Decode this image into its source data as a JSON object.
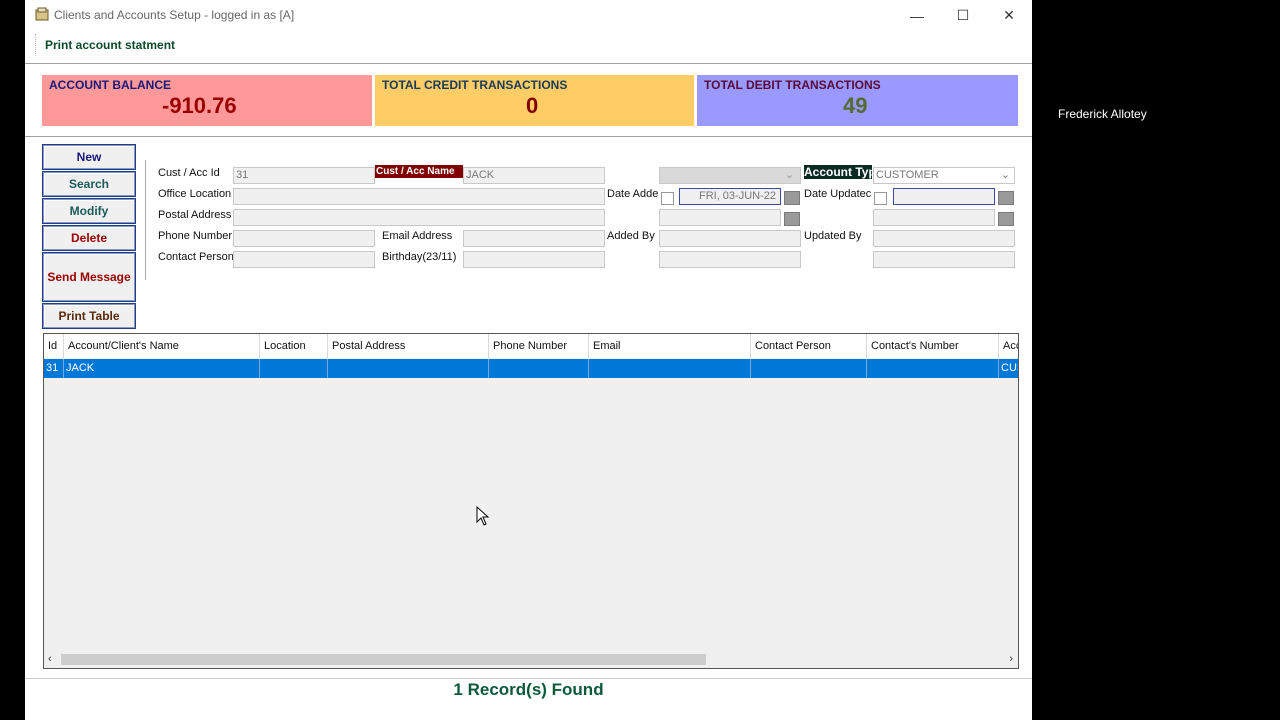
{
  "window": {
    "title": "Clients and Accounts Setup - logged in as [A]"
  },
  "toolbar": {
    "print_statement": "Print account statment"
  },
  "cards": {
    "balance": {
      "label": "ACCOUNT BALANCE",
      "value": "-910.76",
      "bg": "#ff9999",
      "color": "#9a0000"
    },
    "credit": {
      "label": "TOTAL CREDIT TRANSACTIONS",
      "value": "0",
      "bg": "#ffcc66",
      "color": "#800000"
    },
    "debit": {
      "label": "TOTAL DEBIT TRANSACTIONS",
      "value": "49",
      "bg": "#9999ff",
      "color": "#556b2f"
    }
  },
  "buttons": {
    "new": "New",
    "search": "Search",
    "modify": "Modify",
    "delete": "Delete",
    "send_message": "Send Message",
    "print_table": "Print Table"
  },
  "form": {
    "cust_acc_id_label": "Cust / Acc Id",
    "cust_acc_id": "31",
    "cust_acc_name_label": "Cust / Acc Name",
    "cust_acc_name": "JACK",
    "account_type_label": "Account Typ",
    "account_type": "CUSTOMER",
    "office_location_label": "Office Location",
    "postal_address_label": "Postal Address",
    "phone_number_label": "Phone Number",
    "email_label": "Email Address",
    "contact_person_label": "Contact Person",
    "birthday_label": "Birthday(23/11)",
    "date_added_label": "Date Adde",
    "date_added": "FRI, 03-JUN-22",
    "date_updated_label": "Date Updatec",
    "added_by_label": "Added By",
    "updated_by_label": "Updated By"
  },
  "table": {
    "columns": [
      "Id",
      "Account/Client's Name",
      "Location",
      "Postal Address",
      "Phone Number",
      "Email",
      "Contact Person",
      "Contact's Number",
      "Acc"
    ],
    "rows": [
      [
        "31",
        "JACK",
        "",
        "",
        "",
        "",
        "",
        "",
        "CUS"
      ]
    ]
  },
  "status": "1 Record(s) Found",
  "side_panel": {
    "name": "Frederick Allotey"
  }
}
